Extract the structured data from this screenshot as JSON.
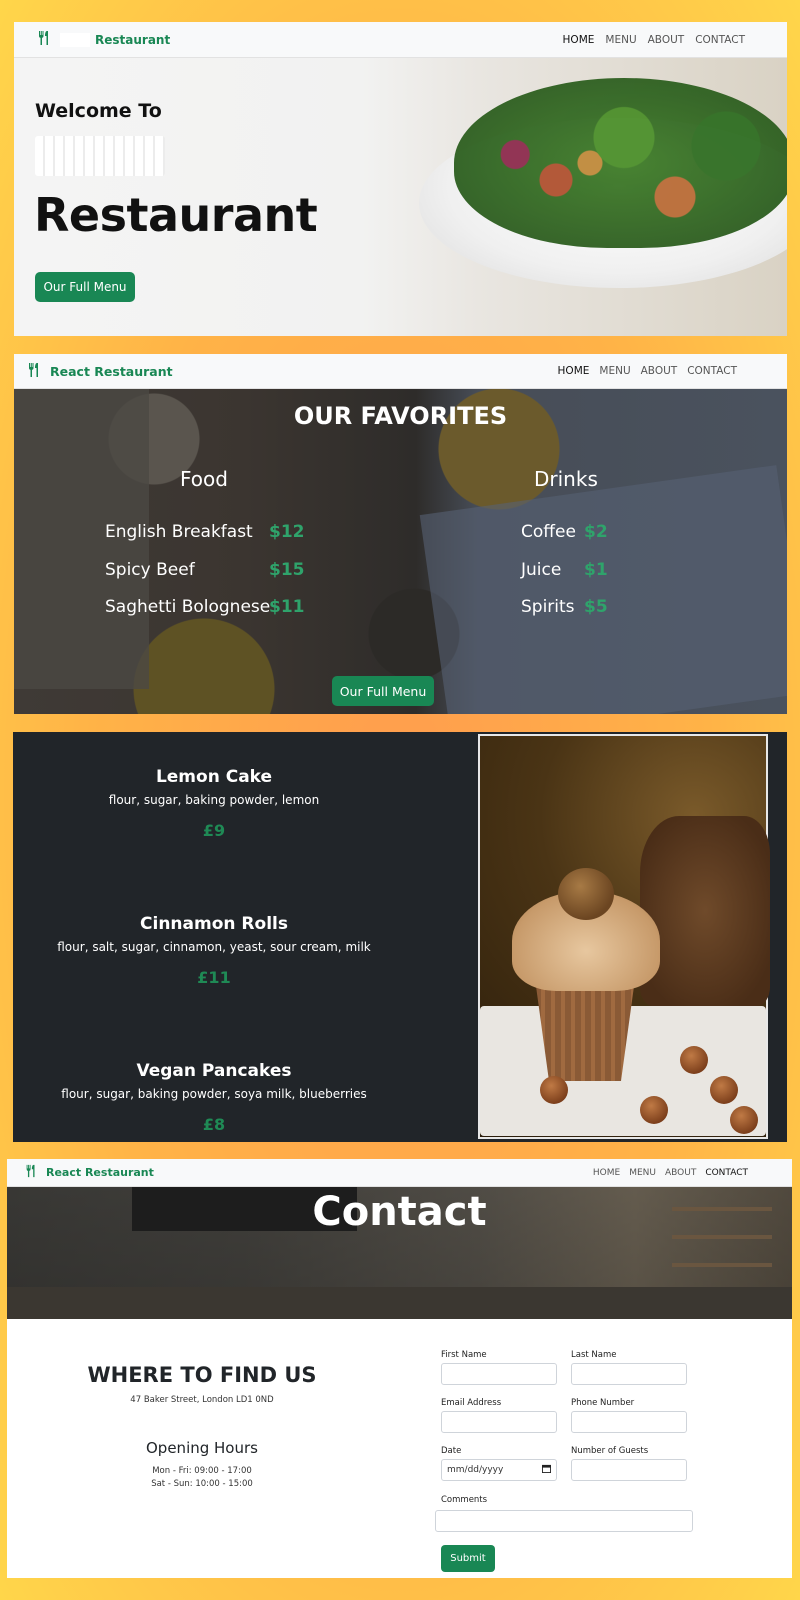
{
  "brand": {
    "name_short": "Restaurant",
    "name": "React Restaurant",
    "icon": "utensils-icon"
  },
  "nav": {
    "home": "HOME",
    "menu": "MENU",
    "about": "ABOUT",
    "contact": "CONTACT"
  },
  "hero": {
    "welcome": "Welcome To",
    "big": "Restaurant",
    "button": "Our Full Menu"
  },
  "favorites": {
    "title": "OUR FAVORITES",
    "food_heading": "Food",
    "drinks_heading": "Drinks",
    "food": [
      {
        "name": "English Breakfast",
        "price": "$12"
      },
      {
        "name": "Spicy Beef",
        "price": "$15"
      },
      {
        "name": "Saghetti Bolognese",
        "price": "$11"
      }
    ],
    "drinks": [
      {
        "name": "Coffee",
        "price": "$2"
      },
      {
        "name": "Juice",
        "price": "$1"
      },
      {
        "name": "Spirits",
        "price": "$5"
      }
    ],
    "button": "Our Full Menu"
  },
  "cakes": [
    {
      "name": "Lemon Cake",
      "ingredients": "flour, sugar, baking powder, lemon",
      "price": "£9"
    },
    {
      "name": "Cinnamon Rolls",
      "ingredients": "flour, salt, sugar, cinnamon, yeast, sour cream, milk",
      "price": "£11"
    },
    {
      "name": "Vegan Pancakes",
      "ingredients": "flour, sugar, baking powder, soya milk, blueberries",
      "price": "£8"
    }
  ],
  "contact": {
    "title": "Contact",
    "find_heading": "WHERE TO FIND US",
    "address": "47 Baker Street, London LD1 0ND",
    "hours_heading": "Opening Hours",
    "hours": [
      "Mon - Fri: 09:00 - 17:00",
      "Sat - Sun: 10:00 - 15:00"
    ],
    "form": {
      "first_name": "First Name",
      "last_name": "Last Name",
      "email": "Email Address",
      "phone": "Phone Number",
      "date": "Date",
      "date_placeholder": "mm/dd/yyyy",
      "guests": "Number of Guests",
      "comments": "Comments",
      "submit": "Submit"
    }
  },
  "colors": {
    "accent": "#198754",
    "dark": "#212529",
    "nav_bg": "#f8f9fa"
  }
}
